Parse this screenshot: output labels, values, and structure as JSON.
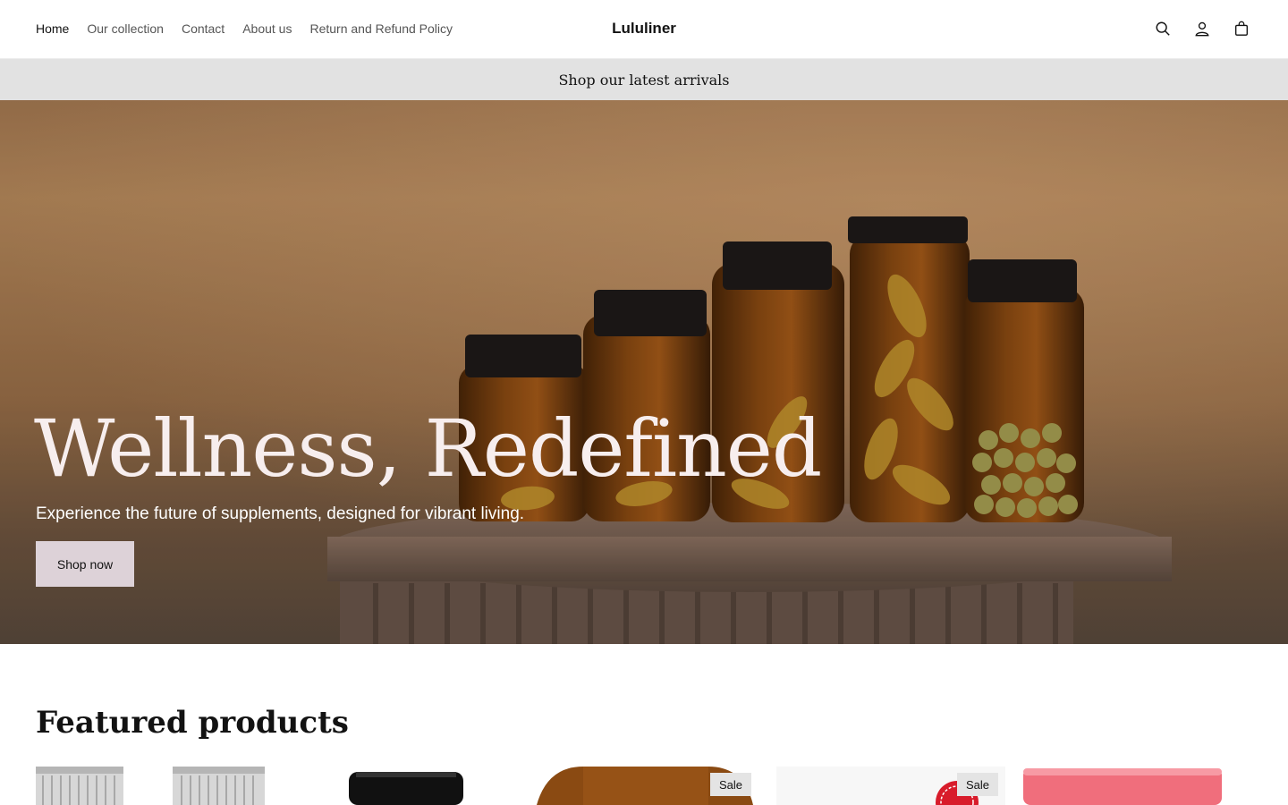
{
  "header": {
    "brand": "Lululiner",
    "nav": [
      {
        "label": "Home",
        "active": true
      },
      {
        "label": "Our collection",
        "active": false
      },
      {
        "label": "Contact",
        "active": false
      },
      {
        "label": "About us",
        "active": false
      },
      {
        "label": "Return and Refund Policy",
        "active": false
      }
    ],
    "icons": [
      "search-icon",
      "account-icon",
      "cart-icon"
    ]
  },
  "announcement": {
    "text": "Shop our latest arrivals"
  },
  "hero": {
    "title": "Wellness, Redefined",
    "subtitle": "Experience the future of supplements, designed for vibrant living.",
    "cta": "Shop now"
  },
  "featured": {
    "title": "Featured products",
    "badges": [
      "Sale",
      "Sale"
    ]
  },
  "colors": {
    "announcement_bg": "#e2e2e2",
    "button_bg": "#ddd2d8",
    "text": "#121212"
  }
}
